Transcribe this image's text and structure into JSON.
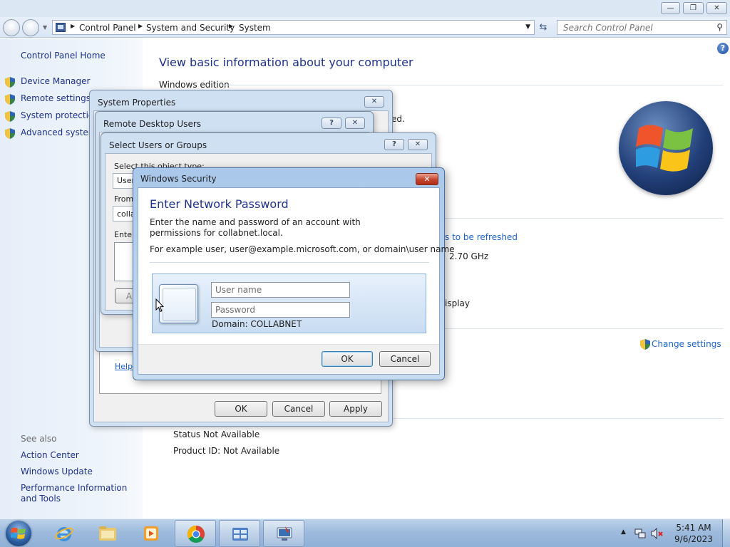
{
  "window": {
    "breadcrumb": [
      "Control Panel",
      "System and Security",
      "System"
    ],
    "search_placeholder": "Search Control Panel"
  },
  "sidebar": {
    "home": "Control Panel Home",
    "tasks": [
      "Device Manager",
      "Remote settings",
      "System protection",
      "Advanced system"
    ],
    "see_also_label": "See also",
    "see_also": [
      "Action Center",
      "Windows Update",
      "Performance Information and Tools"
    ]
  },
  "content": {
    "title": "View basic information about your computer",
    "section_edition": "Windows edition",
    "edition_fragment": "ed.",
    "refresh_link": "s to be refreshed",
    "cpu_speed": "2.70 GHz",
    "display_fragment": "isplay",
    "change_settings": "Change settings",
    "status": "Status Not Available",
    "product_id": "Product ID:  Not Available"
  },
  "system_properties": {
    "title": "System Properties",
    "help_link": "Help",
    "ok": "OK",
    "cancel": "Cancel",
    "apply": "Apply"
  },
  "remote_desktop_users": {
    "title": "Remote Desktop Users"
  },
  "select_users": {
    "title": "Select Users or Groups",
    "object_type_label": "Select this object type:",
    "object_type_value": "User",
    "from_label": "From",
    "from_value": "colla",
    "enter_label": "Enter",
    "add_button": "A"
  },
  "windows_security": {
    "title": "Windows Security",
    "heading": "Enter Network Password",
    "description": "Enter the name and password of an account with permissions for collabnet.local.",
    "example": "For example user, user@example.microsoft.com, or domain\\user name",
    "username_placeholder": "User name",
    "password_placeholder": "Password",
    "domain": "Domain: COLLABNET",
    "ok": "OK",
    "cancel": "Cancel"
  },
  "taskbar": {
    "time": "5:41 AM",
    "date": "9/6/2023",
    "apps": [
      "internet-explorer",
      "windows-explorer",
      "media-player",
      "chrome",
      "control-panel",
      "remote-desktop"
    ]
  }
}
